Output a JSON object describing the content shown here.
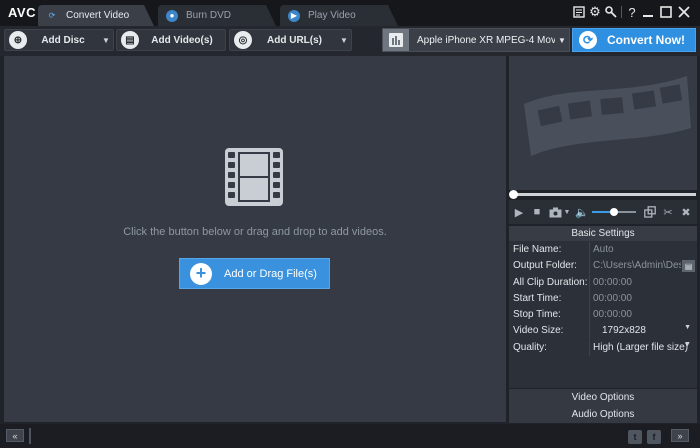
{
  "app": {
    "logo": "AVC"
  },
  "tabs": [
    {
      "label": "Convert Video",
      "icon": "convert-icon",
      "active": true
    },
    {
      "label": "Burn DVD",
      "icon": "disc-icon",
      "active": false
    },
    {
      "label": "Play Video",
      "icon": "play-icon",
      "active": false
    }
  ],
  "toolbar": {
    "add_disc": "Add Disc",
    "add_videos": "Add Video(s)",
    "add_url": "Add URL(s)",
    "profile": "Apple iPhone XR MPEG-4 Movie (*.m...",
    "convert": "Convert Now!"
  },
  "main": {
    "hint": "Click the button below or drag and drop to add videos.",
    "add_file": "Add or Drag File(s)"
  },
  "settings": {
    "header": "Basic Settings",
    "rows": [
      {
        "label": "File Name:",
        "value": "Auto"
      },
      {
        "label": "Output Folder:",
        "value": "C:\\Users\\Admin\\Deskto..."
      },
      {
        "label": "All Clip Duration:",
        "value": "00:00:00"
      },
      {
        "label": "Start Time:",
        "value": "00:00:00"
      },
      {
        "label": "Stop Time:",
        "value": "00:00:00"
      },
      {
        "label": "Video Size:",
        "value": "1792x828"
      },
      {
        "label": "Quality:",
        "value": "High (Larger file size)"
      }
    ],
    "video_options": "Video Options",
    "audio_options": "Audio Options"
  },
  "player": {
    "volume_level": 0.5
  },
  "colors": {
    "accent": "#2f8fe0",
    "background": "#353a44",
    "titlebar": "#15171b"
  }
}
